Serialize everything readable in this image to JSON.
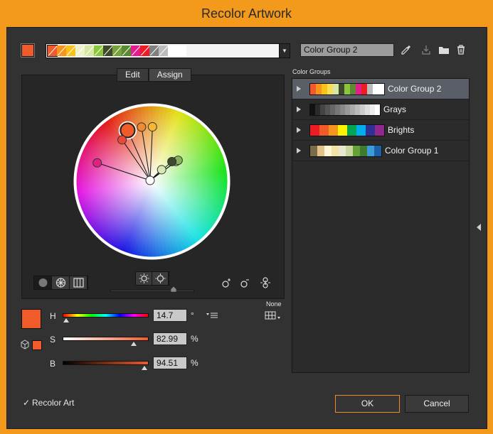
{
  "window": {
    "title": "Recolor Artwork"
  },
  "current_color": "#f15a29",
  "group_strip": {
    "colors": [
      "#f15a29",
      "#f7941d",
      "#f9c21b",
      "#eef2c8",
      "#d6e7a4",
      "#8cc63f",
      "#3f4a2c",
      "#77a33b",
      "#5c8a30",
      "#e41d8c",
      "#ed1c24",
      "#808080",
      "#bcbcbc",
      "#ffffff",
      "#ffffff"
    ]
  },
  "group_name_input": {
    "value": "Color Group 2"
  },
  "toolbar": {
    "eyedropper": "eyedropper-icon",
    "save": "save-changes-icon",
    "folder": "new-group-icon",
    "trash": "delete-icon"
  },
  "tabs": {
    "edit": "Edit",
    "assign": "Assign"
  },
  "wheel": {
    "base_color": {
      "hue": 14.7,
      "saturation": 82.99,
      "brightness": 94.51
    },
    "markers": [
      {
        "color": "#f7b731"
      },
      {
        "color": "#f08c2d"
      },
      {
        "color": "#f15a29",
        "base": true
      },
      {
        "color": "#e9473a"
      },
      {
        "color": "#dd2283"
      },
      {
        "color": "#9ccb6e"
      },
      {
        "color": "#86b45b"
      },
      {
        "color": "#3e4b2c"
      },
      {
        "color": "#d7e8b4"
      },
      {
        "color": "#ffffff"
      }
    ]
  },
  "hsb": {
    "h": {
      "label": "H",
      "value": "14.7",
      "unit": "°",
      "fraction": 0.04
    },
    "s": {
      "label": "S",
      "value": "82.99",
      "unit": "%",
      "fraction": 0.83
    },
    "b": {
      "label": "B",
      "value": "94.51",
      "unit": "%",
      "fraction": 0.95
    }
  },
  "none_label": "None",
  "color_groups": {
    "label": "Color Groups",
    "items": [
      {
        "name": "Color Group 2",
        "selected": true,
        "colors": [
          "#f15a29",
          "#f7941d",
          "#f9c21b",
          "#f6e05a",
          "#d6e7a4",
          "#3f4a2c",
          "#8cc63f",
          "#5c8a30",
          "#e41d8c",
          "#ed1c24",
          "#bcbcbc",
          "#ffffff",
          "#ffffff"
        ]
      },
      {
        "name": "Grays",
        "selected": false,
        "colors": [
          "#111111",
          "#2b2b2b",
          "#444444",
          "#555555",
          "#666666",
          "#777777",
          "#888888",
          "#999999",
          "#aaaaaa",
          "#bbbbbb",
          "#cccccc",
          "#dddddd",
          "#eeeeee",
          "#ffffff"
        ]
      },
      {
        "name": "Brights",
        "selected": false,
        "colors": [
          "#ed1c24",
          "#f15a29",
          "#f7941d",
          "#fff200",
          "#00a651",
          "#00aeef",
          "#2e3192",
          "#92278f"
        ]
      },
      {
        "name": "Color Group 1",
        "selected": false,
        "colors": [
          "#7a6b4a",
          "#e3c389",
          "#fff6d5",
          "#f2e4a5",
          "#e8e8d0",
          "#c8d6a0",
          "#66a036",
          "#3f7a30",
          "#3d9bd7",
          "#1d60a8"
        ]
      }
    ]
  },
  "recolor_art": {
    "label": "Recolor Art",
    "checked": true
  },
  "buttons": {
    "ok": "OK",
    "cancel": "Cancel"
  }
}
